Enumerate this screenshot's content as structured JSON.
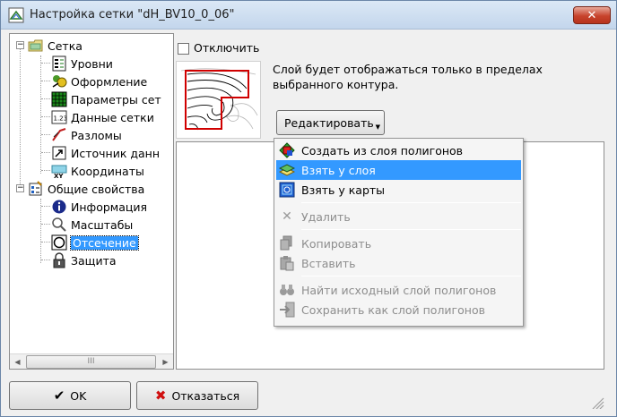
{
  "window": {
    "title": "Настройка сетки \"dH_BV10_0_06\"",
    "close_label": "✕"
  },
  "tree": {
    "items": [
      {
        "label": "Сетка"
      },
      {
        "label": "Уровни"
      },
      {
        "label": "Оформление"
      },
      {
        "label": "Параметры сет"
      },
      {
        "label": "Данные сетки"
      },
      {
        "label": "Разломы"
      },
      {
        "label": "Источник данн"
      },
      {
        "label": "Координаты"
      },
      {
        "label": "Общие свойства"
      },
      {
        "label": "Информация"
      },
      {
        "label": "Масштабы"
      },
      {
        "label": "Отсечение"
      },
      {
        "label": "Защита"
      }
    ],
    "scroll_thumb": "III"
  },
  "panel": {
    "disable_label": "Отключить",
    "description": "Слой будет отображаться только в пределах выбранного контура.",
    "edit_button": "Редактировать"
  },
  "menu": {
    "items": [
      {
        "label": "Создать из слоя полигонов"
      },
      {
        "label": "Взять у слоя"
      },
      {
        "label": "Взять у карты"
      },
      {
        "label": "Удалить"
      },
      {
        "label": "Копировать"
      },
      {
        "label": "Вставить"
      },
      {
        "label": "Найти исходный слой полигонов"
      },
      {
        "label": "Сохранить как слой полигонов"
      }
    ]
  },
  "buttons": {
    "ok": "OK",
    "cancel": "Отказаться"
  },
  "colors": {
    "selection": "#3399ff",
    "close": "#c7432c",
    "contour": "#d00000"
  }
}
